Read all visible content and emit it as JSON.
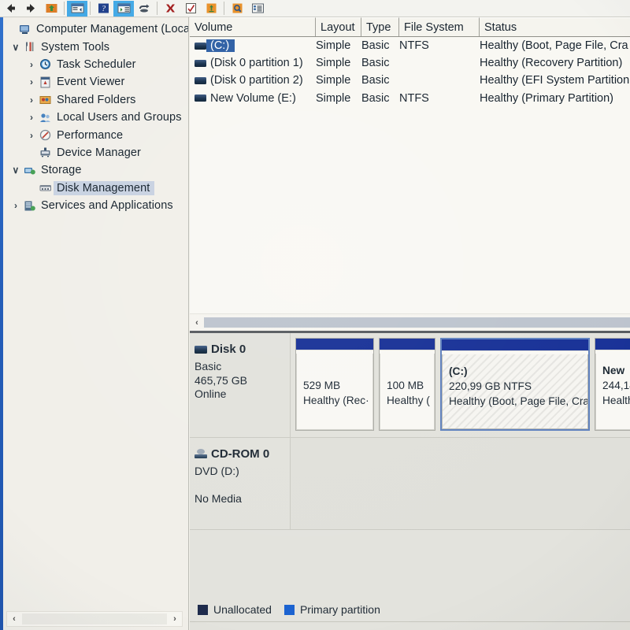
{
  "toolbar": {
    "items": [
      {
        "name": "back-arrow-icon",
        "glyph": "back",
        "selected": false
      },
      {
        "name": "forward-arrow-icon",
        "glyph": "forward",
        "selected": false
      },
      {
        "name": "up-folder-icon",
        "glyph": "upfolder",
        "selected": false
      },
      {
        "name": "show-hide-console-tree-icon",
        "glyph": "tree",
        "selected": true
      },
      {
        "name": "help-icon",
        "glyph": "help",
        "selected": false
      },
      {
        "name": "show-hide-action-pane-icon",
        "glyph": "actionpane",
        "selected": true
      },
      {
        "name": "refresh-icon",
        "glyph": "refresh",
        "selected": false
      },
      {
        "name": "delete-icon",
        "glyph": "delete",
        "selected": false
      },
      {
        "name": "properties-check-icon",
        "glyph": "checklist",
        "selected": false
      },
      {
        "name": "export-list-icon",
        "glyph": "exportfolder",
        "selected": false
      },
      {
        "name": "search-folder-icon",
        "glyph": "searchfolder",
        "selected": false
      },
      {
        "name": "details-list-icon",
        "glyph": "detailslist",
        "selected": false
      }
    ]
  },
  "tree": {
    "nodes": [
      {
        "label": "Computer Management (Local",
        "chevron": "",
        "icon": "computer-icon",
        "indent": 0,
        "selected": false
      },
      {
        "label": "System Tools",
        "chevron": "∨",
        "icon": "tools-icon",
        "indent": 1,
        "selected": false
      },
      {
        "label": "Task Scheduler",
        "chevron": "›",
        "icon": "clock-icon",
        "indent": 2,
        "selected": false
      },
      {
        "label": "Event Viewer",
        "chevron": "›",
        "icon": "eventviewer-icon",
        "indent": 2,
        "selected": false
      },
      {
        "label": "Shared Folders",
        "chevron": "›",
        "icon": "sharedfolders-icon",
        "indent": 2,
        "selected": false
      },
      {
        "label": "Local Users and Groups",
        "chevron": "›",
        "icon": "users-icon",
        "indent": 2,
        "selected": false
      },
      {
        "label": "Performance",
        "chevron": "›",
        "icon": "performance-icon",
        "indent": 2,
        "selected": false
      },
      {
        "label": "Device Manager",
        "chevron": "",
        "icon": "devicemanager-icon",
        "indent": 2,
        "selected": false
      },
      {
        "label": "Storage",
        "chevron": "∨",
        "icon": "storage-icon",
        "indent": 1,
        "selected": false
      },
      {
        "label": "Disk Management",
        "chevron": "",
        "icon": "diskmanagement-icon",
        "indent": 2,
        "selected": true
      },
      {
        "label": "Services and Applications",
        "chevron": "›",
        "icon": "services-icon",
        "indent": 1,
        "selected": false
      }
    ]
  },
  "volume_list": {
    "columns": [
      {
        "label": "Volume",
        "width": 160
      },
      {
        "label": "Layout",
        "width": 58
      },
      {
        "label": "Type",
        "width": 48
      },
      {
        "label": "File System",
        "width": 102
      },
      {
        "label": "Status",
        "width": 195
      }
    ],
    "rows": [
      {
        "volume": "(C:)",
        "layout": "Simple",
        "type": "Basic",
        "filesystem": "NTFS",
        "status": "Healthy (Boot, Page File, Cra",
        "selected": true
      },
      {
        "volume": "(Disk 0 partition 1)",
        "layout": "Simple",
        "type": "Basic",
        "filesystem": "",
        "status": "Healthy (Recovery Partition)",
        "selected": false
      },
      {
        "volume": "(Disk 0 partition 2)",
        "layout": "Simple",
        "type": "Basic",
        "filesystem": "",
        "status": "Healthy (EFI System Partition",
        "selected": false
      },
      {
        "volume": "New Volume (E:)",
        "layout": "Simple",
        "type": "Basic",
        "filesystem": "NTFS",
        "status": "Healthy (Primary Partition)",
        "selected": false
      }
    ]
  },
  "disks": [
    {
      "name": "Disk 0",
      "icon": "disk-icon",
      "type": "Basic",
      "capacity": "465,75 GB",
      "state": "Online",
      "partitions": [
        {
          "name": "",
          "size": "529 MB",
          "status": "Healthy (Rec·",
          "width": 100,
          "selected": false
        },
        {
          "name": "",
          "size": "100 MB",
          "status": "Healthy (",
          "width": 72,
          "selected": false
        },
        {
          "name": "(C:)",
          "size": "220,99 GB NTFS",
          "status": "Healthy (Boot, Page File, Cra·",
          "width": 190,
          "selected": true
        },
        {
          "name": "New",
          "size": "244,14",
          "status": "Health",
          "width": 60,
          "selected": false
        }
      ]
    },
    {
      "name": "CD-ROM 0",
      "icon": "cdrom-icon",
      "type": "DVD (D:)",
      "capacity": "",
      "state": "No Media",
      "partitions": []
    }
  ],
  "legend": {
    "items": [
      {
        "label": "Unallocated",
        "color": "#1c2a4d"
      },
      {
        "label": "Primary partition",
        "color": "#1562d6"
      }
    ]
  },
  "scrollbars": {
    "left_arrow": "‹",
    "right_arrow": "›"
  },
  "colors": {
    "selection_blue": "#2a5fa8",
    "partition_cap_blue": "#15309c",
    "toolbar_selected": "#3ba7e8",
    "desktop_blue": "#1f63c4"
  }
}
